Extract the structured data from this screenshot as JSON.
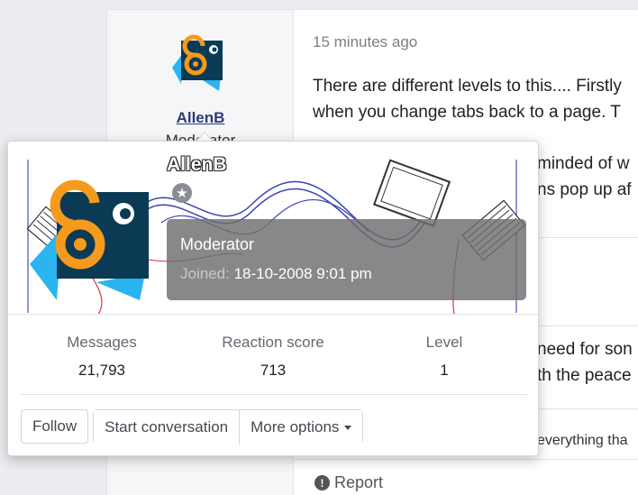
{
  "post": {
    "username": "AllenB",
    "user_title": "Moderator",
    "time": "15 minutes ago",
    "text_lines": [
      "There are different levels to this.... Firstly",
      "when you change tabs back to a page. T"
    ],
    "fragments": [
      "minded of w",
      "ns pop up af",
      "need for son",
      "th the peace",
      "everything tha"
    ],
    "report_label": "Report"
  },
  "tooltip": {
    "username": "AllenB",
    "role": "Moderator",
    "joined_label": "Joined:",
    "joined_value": "18-10-2008 9:01 pm",
    "stats": [
      {
        "label": "Messages",
        "value": "21,793"
      },
      {
        "label": "Reaction score",
        "value": "713"
      },
      {
        "label": "Level",
        "value": "1"
      }
    ],
    "actions": {
      "follow": "Follow",
      "start_conversation": "Start conversation",
      "more_options": "More options"
    }
  },
  "colors": {
    "avatar_bg": "#0b3a55",
    "avatar_lock": "#f59a1c",
    "avatar_accent": "#2ab4f0",
    "username_link": "#2d3a78"
  },
  "icons": {
    "star": "star-icon",
    "report": "alert-circle-icon",
    "dropdown": "caret-down-icon"
  }
}
